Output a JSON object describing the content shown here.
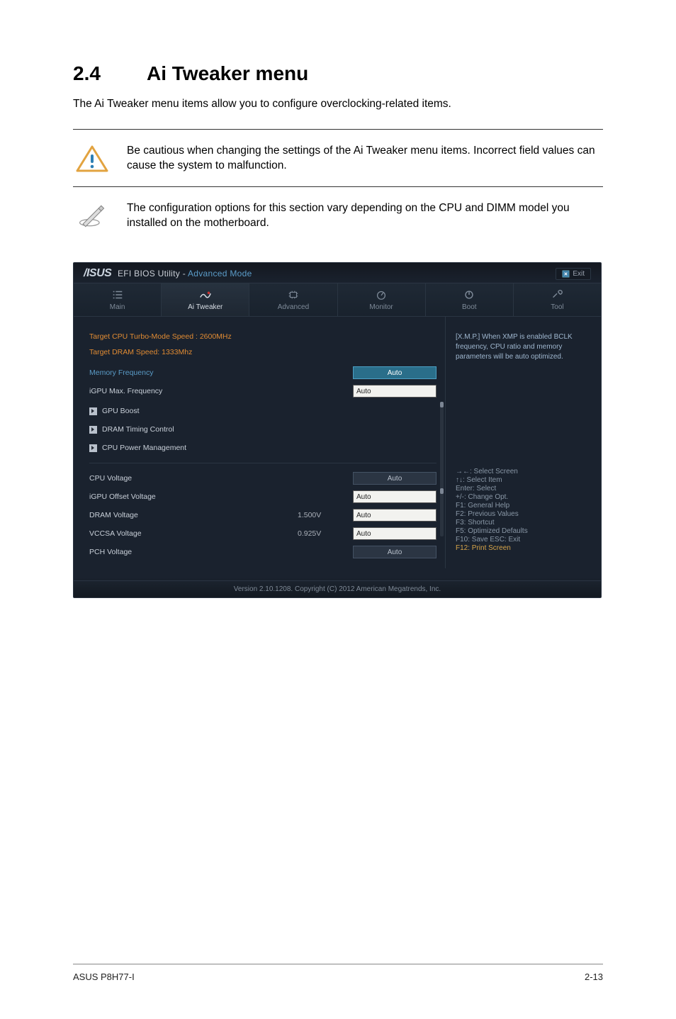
{
  "heading": {
    "num": "2.4",
    "title": "Ai Tweaker menu"
  },
  "intro": "The Ai Tweaker menu items allow you to configure overclocking-related items.",
  "notes": [
    "Be cautious when changing the settings of the Ai Tweaker menu items. Incorrect field values can cause the system to malfunction.",
    "The configuration options for this section vary depending on the CPU and DIMM model you installed on the motherboard."
  ],
  "bios": {
    "titlePrefix": "EFI BIOS Utility - ",
    "titleMode": "Advanced Mode",
    "exit": "Exit",
    "tabs": [
      "Main",
      "Ai Tweaker",
      "Advanced",
      "Monitor",
      "Boot",
      "Tool"
    ],
    "activeTab": 1,
    "info": [
      "Target CPU Turbo-Mode Speed : 2600MHz",
      "Target DRAM Speed: 1333Mhz"
    ],
    "rows": {
      "memFreq": {
        "label": "Memory Frequency",
        "value": "Auto"
      },
      "igpuMax": {
        "label": "iGPU Max. Frequency",
        "value": "Auto"
      },
      "gpuBoost": {
        "label": "GPU Boost"
      },
      "dramTiming": {
        "label": "DRAM Timing Control"
      },
      "cpuPower": {
        "label": "CPU Power Management"
      },
      "cpuV": {
        "label": "CPU Voltage",
        "value": "Auto"
      },
      "igpuOff": {
        "label": "iGPU Offset Voltage",
        "value": "Auto"
      },
      "dramV": {
        "label": "DRAM Voltage",
        "reading": "1.500V",
        "value": "Auto"
      },
      "vccsa": {
        "label": "VCCSA Voltage",
        "reading": "0.925V",
        "value": "Auto"
      },
      "pchV": {
        "label": "PCH Voltage",
        "value": "Auto"
      }
    },
    "help": "[X.M.P.] When XMP is enabled BCLK frequency, CPU ratio and memory parameters will be auto optimized.",
    "keys": [
      "→←: Select Screen",
      "↑↓: Select Item",
      "Enter: Select",
      "+/-: Change Opt.",
      "F1: General Help",
      "F2: Previous Values",
      "F3: Shortcut",
      "F5: Optimized Defaults",
      "F10: Save   ESC: Exit",
      "F12: Print Screen"
    ],
    "footer": "Version  2.10.1208.   Copyright  (C)  2012  American  Megatrends,  Inc."
  },
  "pageFooter": {
    "left": "ASUS P8H77-I",
    "right": "2-13"
  }
}
